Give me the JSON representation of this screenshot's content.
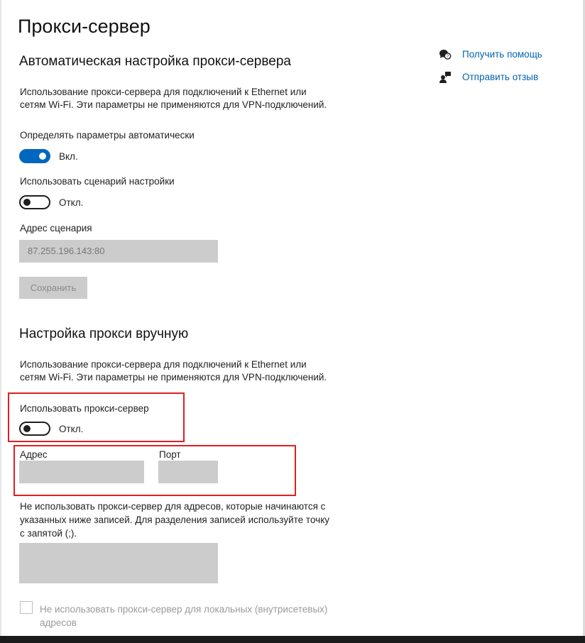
{
  "page": {
    "title": "Прокси-сервер"
  },
  "auto_section": {
    "title": "Автоматическая настройка прокси-сервера",
    "description_line1": "Использование прокси-сервера для подключений к Ethernet или",
    "description_line2": "сетям Wi-Fi. Эти параметры не применяются для VPN-подключений.",
    "detect_label": "Определять параметры автоматически",
    "detect_state": "Вкл.",
    "script_label": "Использовать сценарий настройки",
    "script_state": "Откл.",
    "script_address_label": "Адрес сценария",
    "script_address_value": "87.255.196.143:80",
    "save_button": "Сохранить"
  },
  "manual_section": {
    "title": "Настройка прокси вручную",
    "description_line1": "Использование прокси-сервера для подключений к Ethernet или",
    "description_line2": "сетям Wi-Fi. Эти параметры не применяются для VPN-подключений.",
    "use_proxy_label": "Использовать прокси-сервер",
    "use_proxy_state": "Откл.",
    "address_label": "Адрес",
    "address_value": "",
    "port_label": "Порт",
    "port_value": "",
    "exceptions_line1": "Не использовать прокси-сервер для адресов, которые начинаются с",
    "exceptions_line2": "указанных ниже записей. Для разделения записей используйте точку",
    "exceptions_line3": "с запятой (;).",
    "exceptions_value": "",
    "local_bypass_line1": "Не использовать прокси-сервер для локальных (внутрисетевых)",
    "local_bypass_line2": "адресов",
    "local_bypass_checked": false
  },
  "side_links": {
    "help": "Получить помощь",
    "feedback": "Отправить отзыв"
  },
  "icons": {
    "help": "help-chat-icon",
    "feedback": "feedback-person-icon"
  },
  "colors": {
    "accent": "#0067c0",
    "link": "#0063b1",
    "highlight": "#e0201f",
    "disabled_field": "#cccccc"
  }
}
